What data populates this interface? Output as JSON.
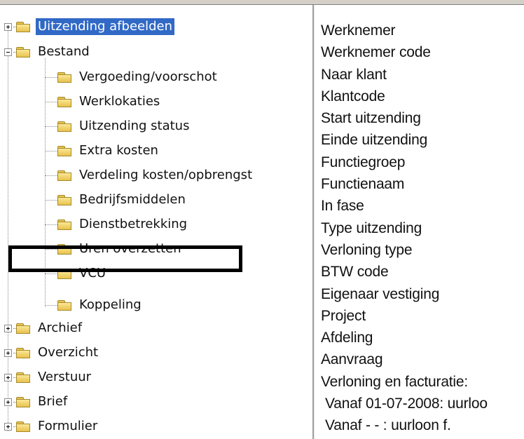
{
  "tree": {
    "items": [
      {
        "label": "Uitzending afbeelden",
        "toggle": "plus",
        "selected": true
      },
      {
        "label": "Bestand",
        "toggle": "minus",
        "selected": false
      },
      {
        "label": "Vergoeding/voorschot",
        "child": true
      },
      {
        "label": "Werklokaties",
        "child": true
      },
      {
        "label": "Uitzending status",
        "child": true
      },
      {
        "label": "Extra kosten",
        "child": true
      },
      {
        "label": "Verdeling kosten/opbrengst",
        "child": true
      },
      {
        "label": "Bedrijfsmiddelen",
        "child": true
      },
      {
        "label": "Dienstbetrekking",
        "child": true
      },
      {
        "label": "Uren overzetten",
        "child": true,
        "highlighted": true
      },
      {
        "label": "VCU",
        "child": true
      },
      {
        "label": "Koppeling",
        "child": true
      },
      {
        "label": "Archief",
        "toggle": "plus"
      },
      {
        "label": "Overzicht",
        "toggle": "plus"
      },
      {
        "label": "Verstuur",
        "toggle": "plus"
      },
      {
        "label": "Brief",
        "toggle": "plus"
      },
      {
        "label": "Formulier",
        "toggle": "plus"
      }
    ]
  },
  "details": {
    "fields": [
      "Werknemer",
      "Werknemer code",
      "Naar klant",
      "Klantcode",
      "Start uitzending",
      "Einde uitzending",
      "Functiegroep",
      "Functienaam",
      "In fase",
      "Type uitzending",
      "Verloning type",
      "BTW code",
      "Eigenaar vestiging",
      "Project",
      "Afdeling",
      "Aanvraag",
      "Verloning en facturatie:",
      "Vanaf 01-07-2008: uurloo",
      "Vanaf  - - : uurloon f."
    ]
  },
  "colors": {
    "selection": "#3169c6",
    "folder": "#e8c24d",
    "highlight_border": "#000000"
  }
}
